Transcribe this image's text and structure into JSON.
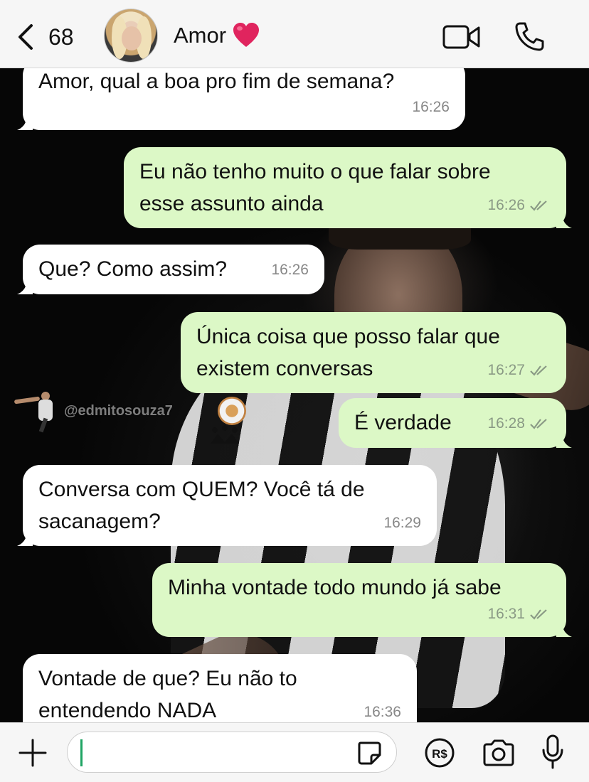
{
  "header": {
    "back_count": "68",
    "contact_name": "Amor",
    "heart_emoji_color": "#e0245e"
  },
  "watermark": "@edmitosouza7",
  "messages": [
    {
      "direction": "in",
      "text": "Amor, qual a boa pro fim de semana?",
      "time": "16:26"
    },
    {
      "direction": "out",
      "text": "Eu não tenho muito o que falar sobre\nesse assunto ainda",
      "time": "16:26",
      "status": "read"
    },
    {
      "direction": "in",
      "text": "Que? Como assim?",
      "time": "16:26"
    },
    {
      "direction": "out",
      "text": "Única coisa que posso falar que\nexistem conversas",
      "time": "16:27",
      "status": "read"
    },
    {
      "direction": "out",
      "text": "É verdade",
      "time": "16:28",
      "status": "read"
    },
    {
      "direction": "in",
      "text": "Conversa com QUEM? Você tá de\nsacanagem?",
      "time": "16:29"
    },
    {
      "direction": "out",
      "text": "Minha vontade todo mundo já sabe",
      "time": "16:31",
      "status": "read"
    },
    {
      "direction": "in",
      "text": "Vontade de que? Eu não to\nentendendo NADA",
      "time": "16:36"
    }
  ],
  "input": {
    "value": "",
    "pay_label": "R$"
  },
  "colors": {
    "incoming_bubble": "#ffffff",
    "outgoing_bubble": "#dcf8c6",
    "header_bg": "#f6f6f6",
    "caret": "#1fa463"
  },
  "icons": [
    "chevron-left-icon",
    "heart-icon",
    "video-call-icon",
    "phone-icon",
    "plus-icon",
    "sticker-icon",
    "payment-icon",
    "camera-icon",
    "microphone-icon",
    "double-check-icon"
  ]
}
